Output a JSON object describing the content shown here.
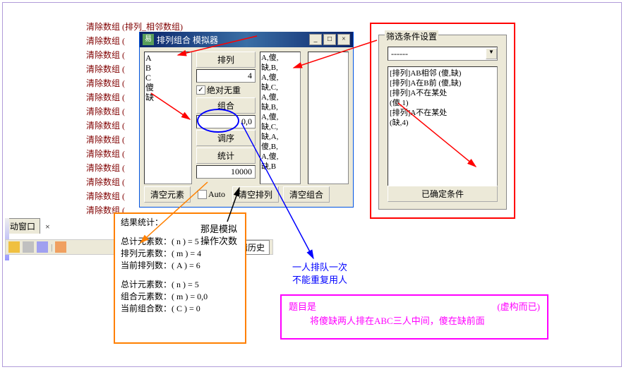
{
  "left_lines": [
    "清除数组 (排列_相邻数组)",
    "清除数组 (",
    "清除数组 (",
    "清除数组 (",
    "清除数组 (",
    "清除数组 (",
    "清除数组 (",
    "清除数组 (",
    "清除数组 (",
    "清除数组 (",
    "清除数组 (",
    "清除数组 (",
    "清除数组 (",
    "清除数组 ("
  ],
  "sim": {
    "title": "排列组合 模拟器",
    "left_elems": "A\nB\nC\n傻\n缺",
    "arrange_btn": "排列",
    "n_input": "4",
    "check_label": "绝对无重",
    "combine_btn": "组合",
    "combine_input": "0,0",
    "order_btn": "调序",
    "stat_btn": "统计",
    "iter_input": "10000",
    "results": "A,傻,\n缺,B,\nA,傻,\n缺,C,\nA,傻,\n缺,B,\nA,傻,\n缺,C,\n缺,A,\n傻,B,\nA,傻,\n缺,B",
    "clear_elem": "清空元素",
    "auto_label": "Auto",
    "clear_arrange": "清空排列",
    "clear_combo": "清空组合"
  },
  "filter": {
    "group": "筛选条件设置",
    "select": "------",
    "items": [
      "[排列]AB相邻 (傻,缺)",
      "[排列]A在B前 (傻,缺)",
      "[排列]A不在某处",
      "(傻,1)",
      "[排列]A不在某处",
      "(缺,4)"
    ],
    "confirm": "已确定条件"
  },
  "stat": {
    "header": "结果统计：",
    "l1": "总计元素数：( n ) = 5",
    "l2": "排列元素数：( m ) = 4",
    "l3": "当前排列数：( A ) = 6",
    "l4": "总计元素数：( n ) = 5",
    "l5": "组合元素数：( m ) = 0,0",
    "l6": "当前组合数：( C ) = 0"
  },
  "ide": {
    "tab": "动窗口",
    "history": "剪辑历史"
  },
  "black_note": {
    "l1": "那是模拟",
    "l2": "操作次数"
  },
  "blue_note": {
    "l1": "一人排队一次",
    "l2": "不能重复用人"
  },
  "magenta": {
    "l1": "题目是",
    "paren": "(虚构而已)",
    "l2": "将傻缺两人排在ABC三人中间，傻在缺前面"
  }
}
